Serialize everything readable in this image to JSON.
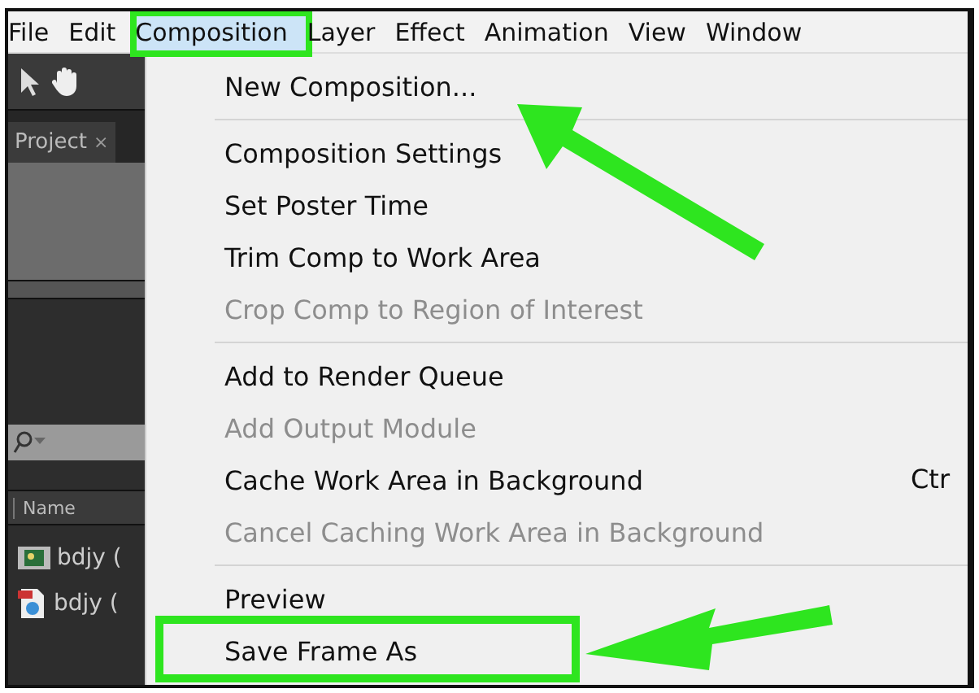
{
  "menubar": [
    {
      "label": "File",
      "selected": false
    },
    {
      "label": "Edit",
      "selected": false
    },
    {
      "label": "Composition",
      "selected": true
    },
    {
      "label": "Layer",
      "selected": false
    },
    {
      "label": "Effect",
      "selected": false
    },
    {
      "label": "Animation",
      "selected": false
    },
    {
      "label": "View",
      "selected": false
    },
    {
      "label": "Window",
      "selected": false
    }
  ],
  "panel": {
    "tab": {
      "label": "Project",
      "close": "×"
    },
    "column": "Name",
    "rows": [
      {
        "kind": "composition",
        "name": "bdjy ("
      },
      {
        "kind": "file",
        "name": "bdjy ("
      }
    ]
  },
  "menu": [
    {
      "kind": "item",
      "label": "New Composition...",
      "disabled": false
    },
    {
      "kind": "separator"
    },
    {
      "kind": "item",
      "label": "Composition Settings",
      "disabled": false
    },
    {
      "kind": "item",
      "label": "Set Poster Time",
      "disabled": false
    },
    {
      "kind": "item",
      "label": "Trim Comp to Work Area",
      "disabled": false
    },
    {
      "kind": "item",
      "label": "Crop Comp to Region of Interest",
      "disabled": true
    },
    {
      "kind": "separator"
    },
    {
      "kind": "item",
      "label": "Add to Render Queue",
      "disabled": false
    },
    {
      "kind": "item",
      "label": "Add Output Module",
      "disabled": true
    },
    {
      "kind": "item",
      "label": "Cache Work Area in Background",
      "disabled": false,
      "shortcut": "Ctr"
    },
    {
      "kind": "item",
      "label": "Cancel Caching Work Area in Background",
      "disabled": true
    },
    {
      "kind": "separator"
    },
    {
      "kind": "item",
      "label": "Preview",
      "disabled": false
    },
    {
      "kind": "item",
      "label": "Save Frame As",
      "disabled": false
    }
  ]
}
